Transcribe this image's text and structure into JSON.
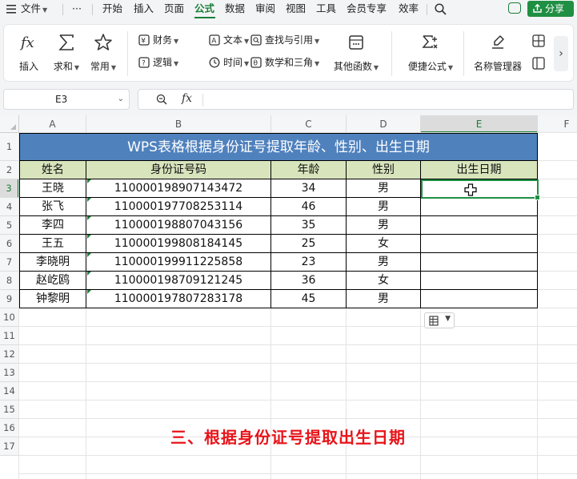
{
  "menubar": {
    "file": "文件",
    "more": "···",
    "tabs": [
      "开始",
      "插入",
      "页面",
      "公式",
      "数据",
      "审阅",
      "视图",
      "工具",
      "会员专享",
      "效率"
    ],
    "active_tab": "公式",
    "share": "分享"
  },
  "ribbon": {
    "insert": "插入",
    "sum": "求和",
    "common": "常用",
    "finance": "财务",
    "logic": "逻辑",
    "text": "文本",
    "time": "时间",
    "lookup": "查找与引用",
    "math": "数学和三角",
    "other": "其他函数",
    "quick_formula": "便捷公式",
    "name_manager": "名称管理器"
  },
  "formula_bar": {
    "cell_ref": "E3",
    "fx": "fx",
    "value": ""
  },
  "grid": {
    "columns": [
      "A",
      "B",
      "C",
      "D",
      "E",
      "F"
    ],
    "rows": [
      "1",
      "2",
      "3",
      "4",
      "5",
      "6",
      "7",
      "8",
      "9",
      "10",
      "11",
      "12",
      "13",
      "14",
      "15",
      "16",
      "17"
    ],
    "selected_column": "E",
    "selected_row": "3"
  },
  "table": {
    "title": "WPS表格根据身份证号提取年龄、性别、出生日期",
    "headers": [
      "姓名",
      "身份证号码",
      "年龄",
      "性别",
      "出生日期"
    ],
    "rows": [
      [
        "王晓",
        "110000198907143472",
        "34",
        "男",
        ""
      ],
      [
        "张飞",
        "110000197708253114",
        "46",
        "男",
        ""
      ],
      [
        "李四",
        "110000198807043156",
        "35",
        "男",
        ""
      ],
      [
        "王五",
        "110000199808184145",
        "25",
        "女",
        ""
      ],
      [
        "李晓明",
        "110000199911225858",
        "23",
        "男",
        ""
      ],
      [
        "赵屹鸥",
        "110000198709121245",
        "36",
        "女",
        ""
      ],
      [
        "钟黎明",
        "110000197807283178",
        "45",
        "男",
        ""
      ]
    ]
  },
  "caption": "三、根据身份证号提取出生日期",
  "colors": {
    "accent": "#1a7f37",
    "title_bg": "#4f81bd",
    "header_bg": "#d8e4bc",
    "caption": "#e8141a"
  }
}
